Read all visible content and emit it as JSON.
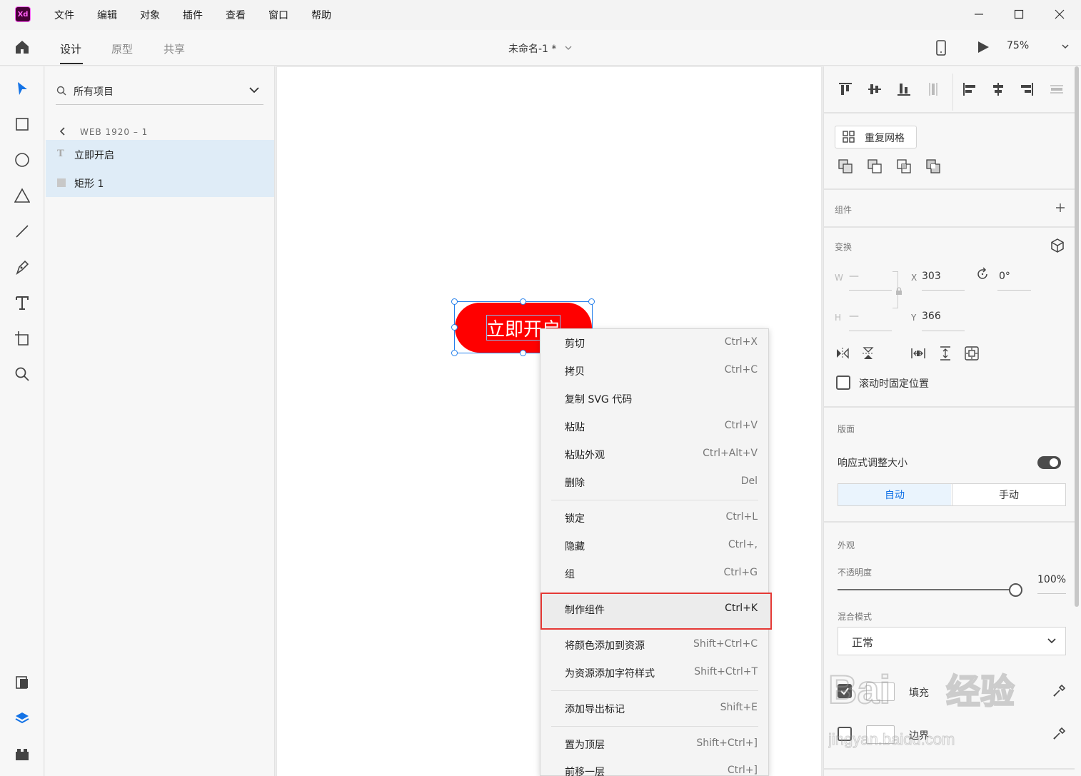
{
  "app": {
    "logo_text": "Xd",
    "menu": [
      "文件",
      "编辑",
      "对象",
      "插件",
      "查看",
      "窗口",
      "帮助"
    ]
  },
  "toolbar": {
    "tabs": [
      "设计",
      "原型",
      "共享"
    ],
    "active_tab": "设计",
    "document_title": "未命名-1 *",
    "zoom": "75%"
  },
  "layers": {
    "search_text": "所有项目",
    "artboard": "WEB 1920 – 1",
    "items": [
      {
        "icon": "text-layer-icon",
        "name": "立即开启"
      },
      {
        "icon": "rectangle-layer-icon",
        "name": "矩形 1"
      }
    ]
  },
  "canvas": {
    "button_text": "立即开启",
    "button_color": "#ff0000",
    "selection_color": "#2680eb"
  },
  "context_menu": {
    "items": [
      {
        "label": "剪切",
        "shortcut": "Ctrl+X"
      },
      {
        "label": "拷贝",
        "shortcut": "Ctrl+C"
      },
      {
        "label": "复制 SVG 代码",
        "shortcut": ""
      },
      {
        "label": "粘贴",
        "shortcut": "Ctrl+V"
      },
      {
        "label": "粘贴外观",
        "shortcut": "Ctrl+Alt+V"
      },
      {
        "label": "删除",
        "shortcut": "Del"
      },
      {
        "label": "锁定",
        "shortcut": "Ctrl+L"
      },
      {
        "label": "隐藏",
        "shortcut": "Ctrl+,"
      },
      {
        "label": "组",
        "shortcut": "Ctrl+G"
      },
      {
        "label": "制作组件",
        "shortcut": "Ctrl+K"
      },
      {
        "label": "将颜色添加到资源",
        "shortcut": "Shift+Ctrl+C"
      },
      {
        "label": "为资源添加字符样式",
        "shortcut": "Shift+Ctrl+T"
      },
      {
        "label": "添加导出标记",
        "shortcut": "Shift+E"
      },
      {
        "label": "置为顶层",
        "shortcut": "Shift+Ctrl+]"
      },
      {
        "label": "前移一层",
        "shortcut": "Ctrl+]"
      }
    ],
    "highlighted": "制作组件",
    "highlight_color": "#e53935"
  },
  "properties": {
    "repeat_grid": "重复网格",
    "component_label": "组件",
    "transform_label": "变换",
    "w_label": "W",
    "w_value": "—",
    "h_label": "H",
    "h_value": "—",
    "x_label": "X",
    "x_value": "303",
    "y_label": "Y",
    "y_value": "366",
    "rotation": "0°",
    "fix_on_scroll": "滚动时固定位置",
    "layout_label": "版面",
    "responsive_resize": "响应式调整大小",
    "responsive_on": true,
    "auto": "自动",
    "manual": "手动",
    "appearance_label": "外观",
    "opacity_label": "不透明度",
    "opacity_value": "100%",
    "blend_label": "混合模式",
    "blend_value": "正常",
    "fill_label": "填充",
    "border_label": "边界"
  },
  "watermark": {
    "text": "Baidu经验",
    "url_text": "jingyan.baidu.com"
  }
}
